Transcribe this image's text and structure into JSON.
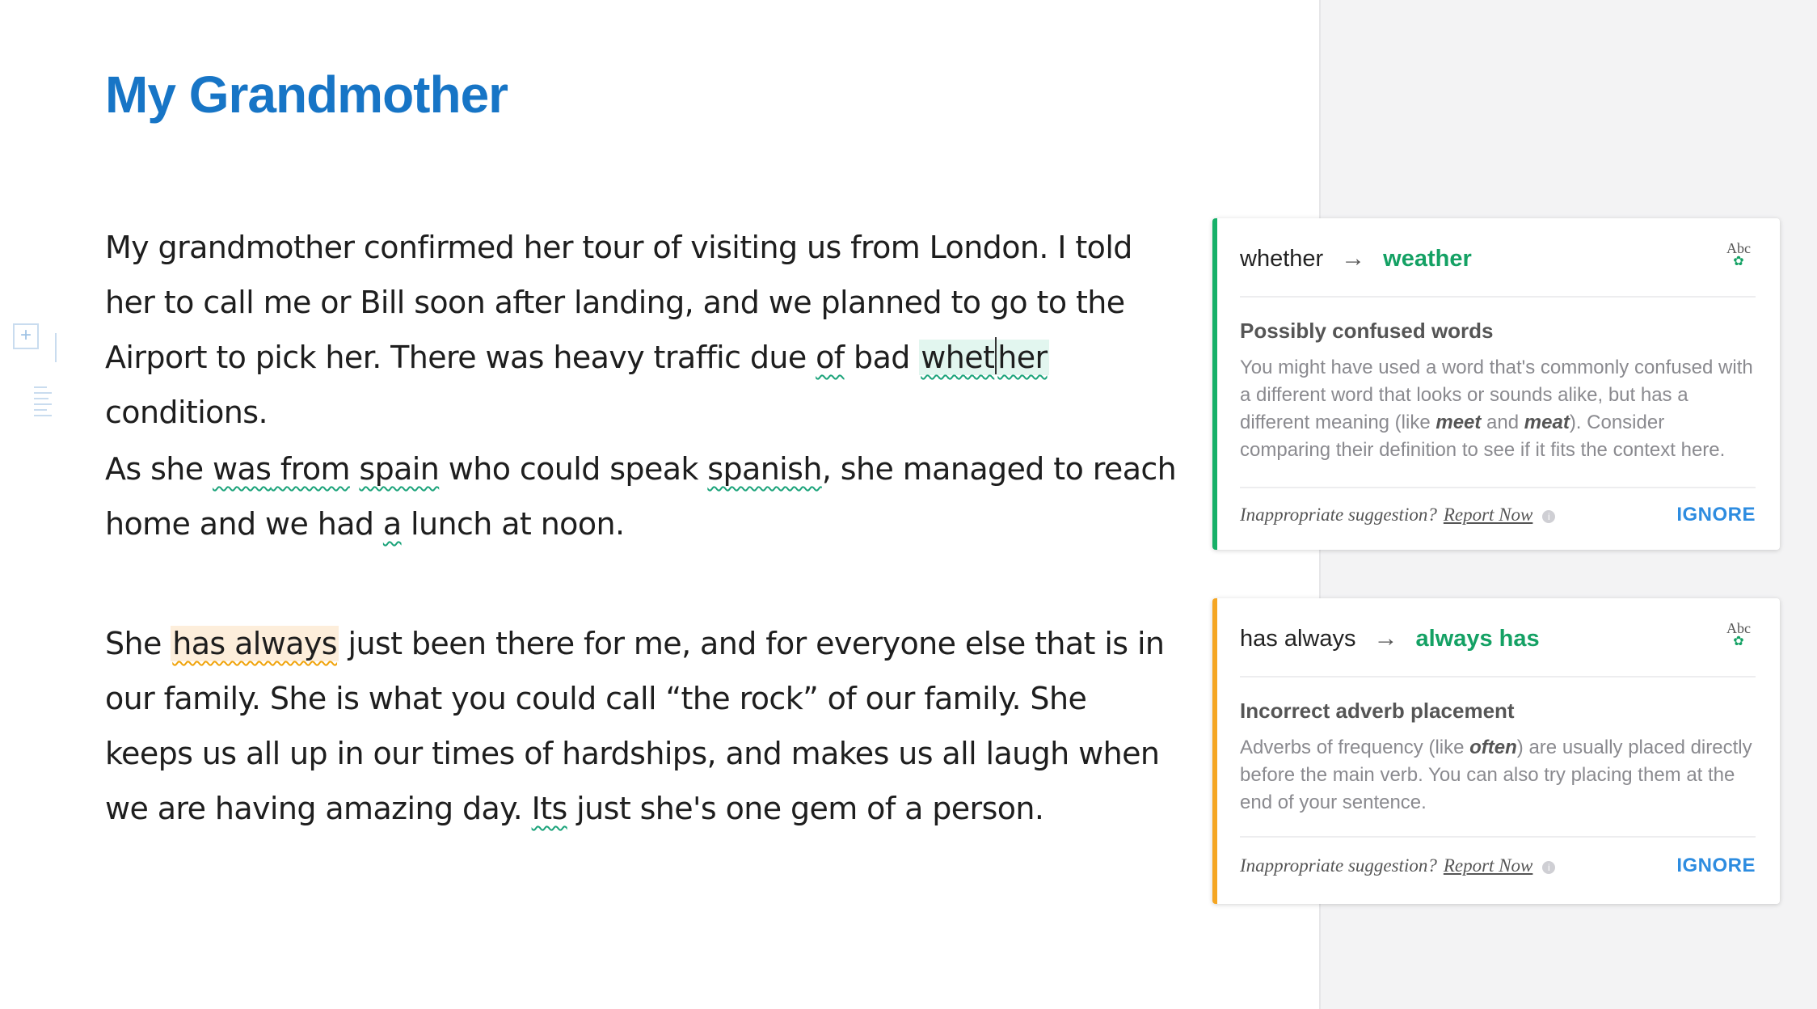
{
  "document": {
    "title": "My Grandmother",
    "p1": {
      "t1": "My grandmother confirmed her tour of visiting us from London. I told her to call me or Bill soon after landing, and we planned to go to the Airport to pick her. There was heavy traffic due ",
      "e1": "of",
      "t2": " bad ",
      "e2a": "whet",
      "e2b": "her",
      "t3": " conditions."
    },
    "p2": {
      "t1": "As she ",
      "e1": "was",
      "t2": "  ",
      "e2": "from",
      "t3": " ",
      "e3": "spain",
      "t4": " who could speak ",
      "e4": "spanish",
      "t5": ", she managed to reach home and we had ",
      "e5": "a",
      "t6": " lunch at noon."
    },
    "p3": {
      "t1": "She ",
      "e1": "has always",
      "t2": " just been there for me, and for everyone else that is in our family. She is what you could call “the rock” of our family. She keeps us all up in our times of hardships, and makes us all laugh when we are having amazing day. ",
      "e2": "Its",
      "t3": " just she's one gem of a person."
    }
  },
  "cards": [
    {
      "original": "whether",
      "arrow": "→",
      "replacement": "weather",
      "badge": "Abc",
      "category": "Possibly confused words",
      "body_1": "You might have used a word that's commonly confused with a different word that looks or sounds alike, but has a different meaning (like ",
      "body_em1": "meet",
      "body_2": " and ",
      "body_em2": "meat",
      "body_3": "). Consider comparing their definition to see if it fits the context here.",
      "footer_question": "Inappropriate suggestion?",
      "report_label": "Report Now",
      "ignore_label": "IGNORE",
      "accent": "#16b068"
    },
    {
      "original": "has always",
      "arrow": "→",
      "replacement": "always has",
      "badge": "Abc",
      "category": "Incorrect adverb placement",
      "body_1": "Adverbs of frequency (like ",
      "body_em1": "often",
      "body_2": ") are usually placed directly before the main verb. You can also try placing them at the end of your sentence.",
      "footer_question": "Inappropriate suggestion?",
      "report_label": "Report Now",
      "ignore_label": "IGNORE",
      "accent": "#f5a623"
    }
  ]
}
